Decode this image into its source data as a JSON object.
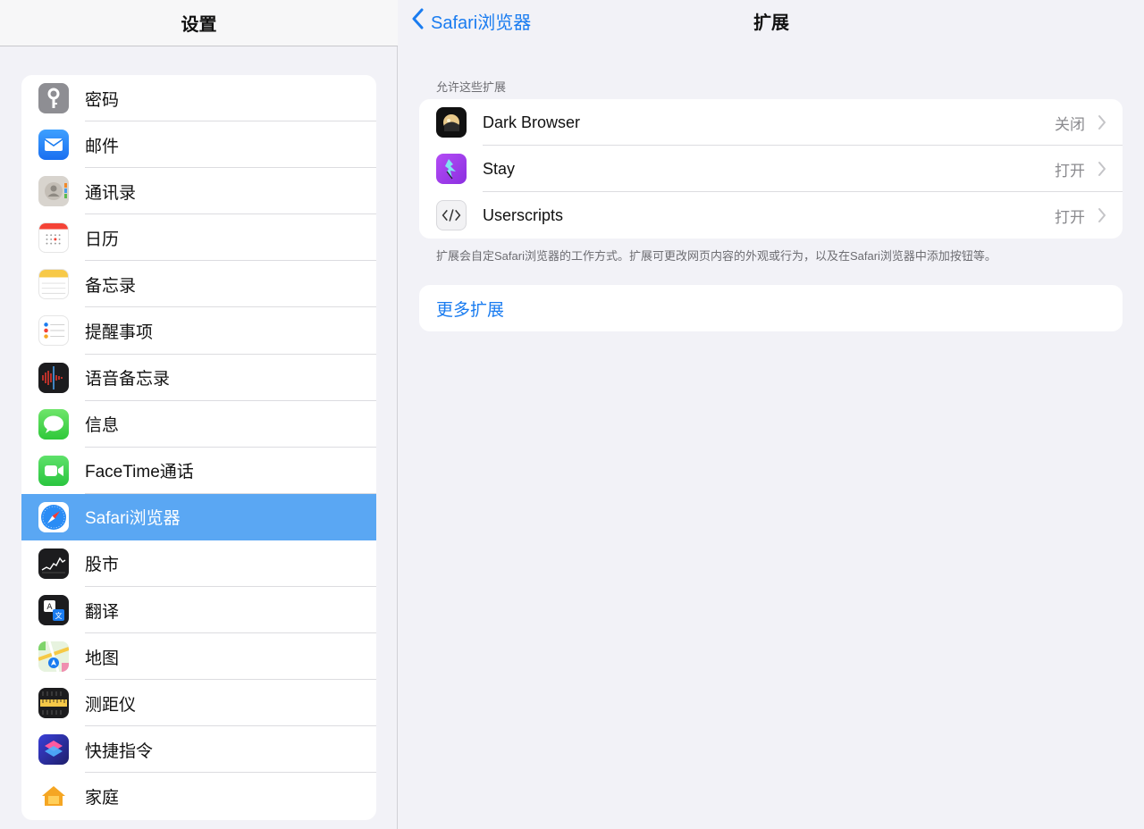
{
  "left": {
    "title": "设置",
    "items": [
      {
        "label": "密码",
        "icon": "key-icon"
      },
      {
        "label": "邮件",
        "icon": "mail-icon"
      },
      {
        "label": "通讯录",
        "icon": "contacts-icon"
      },
      {
        "label": "日历",
        "icon": "calendar-icon"
      },
      {
        "label": "备忘录",
        "icon": "notes-icon"
      },
      {
        "label": "提醒事项",
        "icon": "reminders-icon"
      },
      {
        "label": "语音备忘录",
        "icon": "voice-memos-icon"
      },
      {
        "label": "信息",
        "icon": "messages-icon"
      },
      {
        "label": "FaceTime通话",
        "icon": "facetime-icon"
      },
      {
        "label": "Safari浏览器",
        "icon": "safari-compass-icon",
        "selected": true
      },
      {
        "label": "股市",
        "icon": "stocks-icon"
      },
      {
        "label": "翻译",
        "icon": "translate-icon"
      },
      {
        "label": "地图",
        "icon": "maps-icon"
      },
      {
        "label": "测距仪",
        "icon": "measure-icon"
      },
      {
        "label": "快捷指令",
        "icon": "shortcuts-icon"
      },
      {
        "label": "家庭",
        "icon": "home-icon"
      }
    ]
  },
  "right": {
    "back_label": "Safari浏览器",
    "title": "扩展",
    "section_header": "允许这些扩展",
    "extensions": [
      {
        "name": "Dark Browser",
        "state": "关闭",
        "icon": "dark-browser-icon"
      },
      {
        "name": "Stay",
        "state": "打开",
        "icon": "stay-icon"
      },
      {
        "name": "Userscripts",
        "state": "打开",
        "icon": "userscripts-icon"
      }
    ],
    "section_footer": "扩展会自定Safari浏览器的工作方式。扩展可更改网页内容的外观或行为，以及在Safari浏览器中添加按钮等。",
    "more_label": "更多扩展"
  },
  "colors": {
    "accent": "#1a7cf0",
    "selected_row": "#5aa7f3",
    "background": "#f2f2f7"
  }
}
